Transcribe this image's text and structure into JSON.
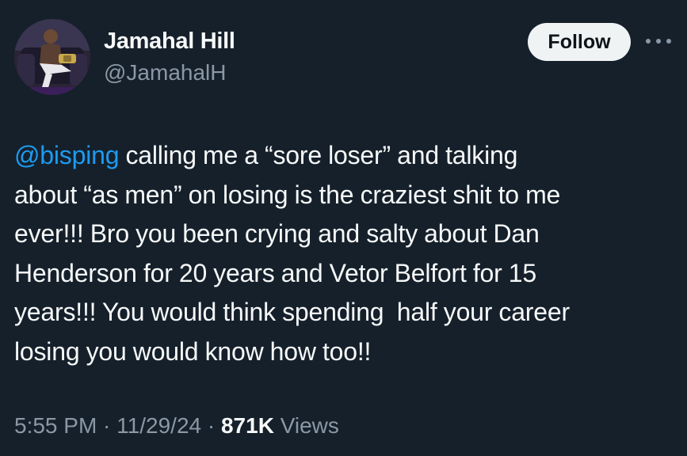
{
  "author": {
    "display_name": "Jamahal Hill",
    "handle": "@JamahalH"
  },
  "follow_label": "Follow",
  "tweet": {
    "mention": "@bisping",
    "line1_rest": " calling me a “sore loser” and talking",
    "line2": "about “as men” on losing is the craziest shit to me",
    "line3": "ever!!! Bro you been crying and salty about Dan",
    "line4": "Henderson for 20 years and Vetor Belfort for 15",
    "line5": "years!!! You would think spending  half your career",
    "line6": "losing you would know how too!!"
  },
  "meta": {
    "time": "5:55 PM",
    "separator1": " · ",
    "date": "11/29/24",
    "separator2": " · ",
    "views_count": "871K",
    "views_label": " Views"
  },
  "colors": {
    "background": "#15202b",
    "text": "#f7f9f9",
    "secondary": "#8b98a5",
    "accent": "#1d9bf0",
    "follow_bg": "#eff3f4"
  },
  "icons": {
    "more": "more-horizontal-icon",
    "avatar": "profile-photo"
  }
}
